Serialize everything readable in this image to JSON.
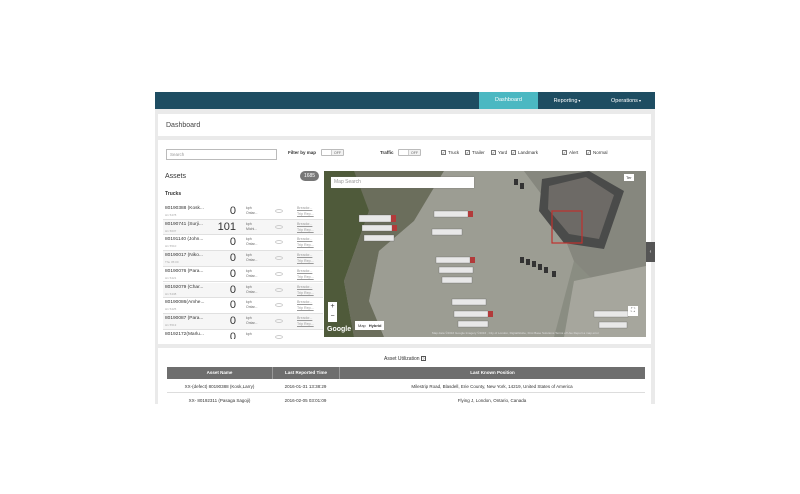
{
  "nav": {
    "items": [
      {
        "label": "Dashboard",
        "active": true
      },
      {
        "label": "Reporting",
        "active": false
      },
      {
        "label": "Operations",
        "active": false
      }
    ]
  },
  "header": {
    "title": "Dashboard"
  },
  "filters": {
    "search_placeholder": "Search",
    "filter_by_map_label": "Filter by map",
    "filter_by_map_state": "OFF",
    "traffic_label": "Traffic",
    "traffic_state": "OFF",
    "checkboxes": [
      {
        "label": "Truck",
        "checked": true
      },
      {
        "label": "Trailer",
        "checked": true
      },
      {
        "label": "Yard",
        "checked": true
      },
      {
        "label": "Landmark",
        "checked": true
      },
      {
        "label": "Alert",
        "checked": true
      },
      {
        "label": "Normal",
        "checked": true
      }
    ]
  },
  "assets": {
    "title": "Assets",
    "count": "1685",
    "section": "Trucks",
    "rows": [
      {
        "name": "80190388 (Kosk...",
        "id": "H1 5478",
        "speed": "0",
        "unit": "kph",
        "region": "Ontar...",
        "link1": "Breadcr...",
        "link2": "Trip Rep..."
      },
      {
        "name": "80190741 (Surji...",
        "id": "H1 5637",
        "speed": "101",
        "unit": "kph",
        "region": "Michi...",
        "link1": "Breadcr...",
        "link2": "Trip Rep..."
      },
      {
        "name": "80191140 (John...",
        "id": "H1 5510",
        "speed": "0",
        "unit": "kph",
        "region": "Ontar...",
        "link1": "Breadcr...",
        "link2": "Trip Rep..."
      },
      {
        "name": "80190017 (Niko...",
        "id": "Thu 05:00",
        "speed": "0",
        "unit": "kph",
        "region": "Ontar...",
        "link1": "Breadcr...",
        "link2": "Trip Rep..."
      },
      {
        "name": "80190076 (Para...",
        "id": "H1 5421",
        "speed": "0",
        "unit": "kph",
        "region": "Ontar...",
        "link1": "Breadcr...",
        "link2": "Trip Rep..."
      },
      {
        "name": "80192079 (Char...",
        "id": "H1 5438",
        "speed": "0",
        "unit": "kph",
        "region": "Ontar...",
        "link1": "Breadcr...",
        "link2": "Trip Rep..."
      },
      {
        "name": "80190086(Amhe...",
        "id": "H1 5425",
        "speed": "0",
        "unit": "kph",
        "region": "Ontar...",
        "link1": "Breadcr...",
        "link2": "Trip Rep..."
      },
      {
        "name": "80190087 (Para...",
        "id": "H1 5513",
        "speed": "0",
        "unit": "kph",
        "region": "Ontar...",
        "link1": "Breadcr...",
        "link2": "Trip Rep..."
      },
      {
        "name": "80192172(Marlu...",
        "id": "",
        "speed": "0",
        "unit": "kph",
        "region": "",
        "link1": "",
        "link2": ""
      }
    ]
  },
  "map": {
    "search_placeholder": "Map Search",
    "zoom_in": "+",
    "zoom_out": "−",
    "type_map": "Map",
    "type_hybrid": "Hybrid",
    "brand": "Google",
    "attribution": "Map data ©2016 Google Imagery ©2016 , City of London, DigitalGlobe, First Base Solutions   Terms of Use   Report a map error",
    "top_right": "Ter"
  },
  "utilization": {
    "title": "Asset Utilization",
    "columns": [
      "Asset Name",
      "Last Reported Time",
      "Last Known Position"
    ],
    "rows": [
      [
        "XX-(defect) 80190388 (Kosk,Larry)",
        "2016-01-31 13:38:29",
        "Milestrip Road, Blasdell, Erie County, New York, 14219, United States of America"
      ],
      [
        "XX- 80192311 (Pasaga Sagoji)",
        "2016-02-05 03:01:09",
        "Flying J, London, Ontario, Canada"
      ]
    ]
  },
  "colors": {
    "navbar": "#1e4d62",
    "active_tab": "#4bb8c2",
    "table_header": "#6e6e6e"
  }
}
